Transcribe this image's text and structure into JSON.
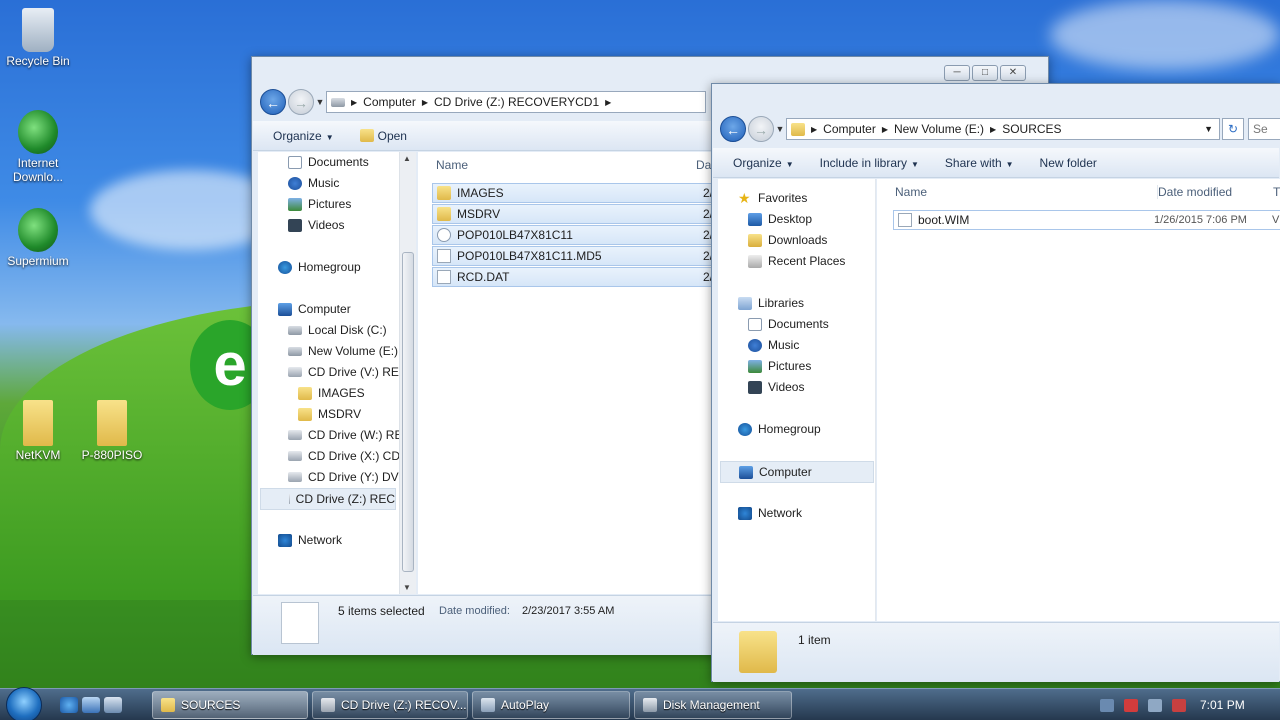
{
  "desktop": {
    "icons": [
      {
        "label": "Recycle Bin"
      },
      {
        "label": "Internet Downlo..."
      },
      {
        "label": "Supermium"
      },
      {
        "label": "NetKVM"
      },
      {
        "label": "P-880PISO"
      }
    ]
  },
  "window_left": {
    "address": {
      "segments": [
        "Computer",
        "CD Drive (Z:) RECOVERYCD1"
      ]
    },
    "toolbar": {
      "organize": "Organize",
      "open": "Open"
    },
    "nav": [
      {
        "label": "Documents"
      },
      {
        "label": "Music"
      },
      {
        "label": "Pictures"
      },
      {
        "label": "Videos"
      },
      {
        "label": "Homegroup"
      },
      {
        "label": "Computer"
      },
      {
        "label": "Local Disk (C:)"
      },
      {
        "label": "New Volume (E:)"
      },
      {
        "label": "CD Drive (V:) REC"
      },
      {
        "label": "IMAGES"
      },
      {
        "label": "MSDRV"
      },
      {
        "label": "CD Drive (W:) RE"
      },
      {
        "label": "CD Drive (X:) CD_"
      },
      {
        "label": "CD Drive (Y:) DVD"
      },
      {
        "label": "CD Drive (Z:) REC"
      },
      {
        "label": "Network"
      }
    ],
    "columns": {
      "name": "Name",
      "date": "Da"
    },
    "files": [
      {
        "name": "IMAGES",
        "date": "2/2"
      },
      {
        "name": "MSDRV",
        "date": "2/2"
      },
      {
        "name": "POP010LB47X81C11",
        "date": "2/2"
      },
      {
        "name": "POP010LB47X81C11.MD5",
        "date": "2/2"
      },
      {
        "name": "RCD.DAT",
        "date": "2/2"
      }
    ],
    "status": {
      "selected": "5 items selected",
      "date_label": "Date modified:",
      "date_value": "2/23/2017 3:55 AM"
    }
  },
  "window_right": {
    "address": {
      "segments": [
        "Computer",
        "New Volume (E:)",
        "SOURCES"
      ],
      "search_placeholder": "Se"
    },
    "toolbar": {
      "organize": "Organize",
      "include": "Include in library",
      "share": "Share with",
      "new_folder": "New folder"
    },
    "nav": [
      {
        "label": "Favorites"
      },
      {
        "label": "Desktop"
      },
      {
        "label": "Downloads"
      },
      {
        "label": "Recent Places"
      },
      {
        "label": "Libraries"
      },
      {
        "label": "Documents"
      },
      {
        "label": "Music"
      },
      {
        "label": "Pictures"
      },
      {
        "label": "Videos"
      },
      {
        "label": "Homegroup"
      },
      {
        "label": "Computer"
      },
      {
        "label": "Network"
      }
    ],
    "columns": {
      "name": "Name",
      "date": "Date modified",
      "type": "T"
    },
    "files": [
      {
        "name": "boot.WIM",
        "date": "1/26/2015 7:06 PM",
        "type": "V"
      }
    ],
    "status": {
      "count": "1 item"
    }
  },
  "taskbar": {
    "buttons": [
      {
        "label": "SOURCES"
      },
      {
        "label": "CD Drive (Z:) RECOV..."
      },
      {
        "label": "AutoPlay"
      },
      {
        "label": "Disk Management"
      }
    ],
    "clock": "7:01 PM"
  }
}
